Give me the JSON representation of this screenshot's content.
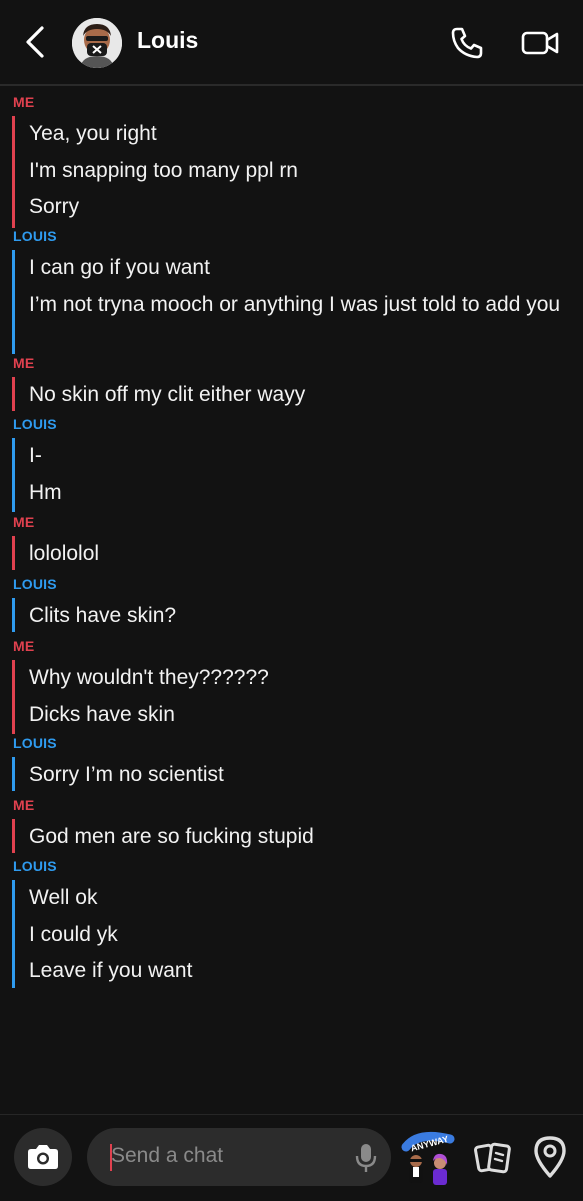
{
  "header": {
    "title": "Louis"
  },
  "conversation": [
    {
      "sender": "ME",
      "who": "me",
      "messages": [
        "Yea, you right",
        "I'm snapping too many ppl rn",
        "Sorry"
      ]
    },
    {
      "sender": "LOUIS",
      "who": "louis",
      "messages": [
        "I can go if you want",
        "I’m not tryna mooch or anything I was just told to add you"
      ]
    },
    {
      "sender": "ME",
      "who": "me",
      "messages": [
        "No skin off my clit either wayy"
      ]
    },
    {
      "sender": "LOUIS",
      "who": "louis",
      "messages": [
        "I-",
        "Hm"
      ]
    },
    {
      "sender": "ME",
      "who": "me",
      "messages": [
        "lolololol"
      ]
    },
    {
      "sender": "LOUIS",
      "who": "louis",
      "messages": [
        "Clits have skin?"
      ]
    },
    {
      "sender": "ME",
      "who": "me",
      "messages": [
        "Why wouldn't they??????",
        "Dicks have skin"
      ]
    },
    {
      "sender": "LOUIS",
      "who": "louis",
      "messages": [
        "Sorry I’m no scientist"
      ]
    },
    {
      "sender": "ME",
      "who": "me",
      "messages": [
        "God men are so fucking stupid"
      ]
    },
    {
      "sender": "LOUIS",
      "who": "louis",
      "messages": [
        "Well ok",
        "I could yk",
        "Leave if you want"
      ]
    }
  ],
  "composer": {
    "placeholder": "Send a chat"
  },
  "sticker_text": "ANYWAY",
  "colors": {
    "me": "#e0414f",
    "louis": "#2f9bef",
    "background": "#121212"
  },
  "icons": [
    "back-arrow-icon",
    "phone-icon",
    "video-camera-icon",
    "camera-icon",
    "microphone-icon",
    "bitmoji-icon",
    "cards-icon",
    "location-pin-icon"
  ]
}
